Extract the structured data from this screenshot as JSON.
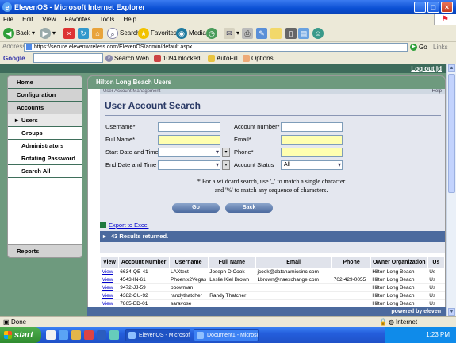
{
  "window": {
    "title": "ElevenOS - Microsoft Internet Explorer"
  },
  "menubar": [
    "File",
    "Edit",
    "View",
    "Favorites",
    "Tools",
    "Help"
  ],
  "toolbar": {
    "back": "Back",
    "search": "Search",
    "favorites": "Favorites",
    "media": "Media"
  },
  "address": {
    "label": "Address",
    "url": "https://secure.elevenwireless.com/ElevenOS/admin/default.aspx",
    "go": "Go",
    "links": "Links"
  },
  "googlebar": {
    "brand": "Google",
    "search_web": "Search Web",
    "blocked": "1094 blocked",
    "autofill": "AutoFill",
    "options": "Options"
  },
  "header": {
    "logout": "Log out jd"
  },
  "sidebar": {
    "items": [
      {
        "label": "Home"
      },
      {
        "label": "Configuration"
      },
      {
        "label": "Accounts"
      },
      {
        "label": "Users"
      },
      {
        "label": "Groups"
      },
      {
        "label": "Administrators"
      },
      {
        "label": "Rotating Password"
      },
      {
        "label": "Search All"
      }
    ],
    "reports": "Reports"
  },
  "main": {
    "title": "Hilton Long Beach  Users",
    "panel_header": "User Account Management",
    "panel_help": "Help",
    "form_title": "User Account Search",
    "fields": {
      "username": "Username*",
      "full_name": "Full Name*",
      "start_date": "Start Date and Time",
      "end_date": "End Date and Time",
      "account_number": "Account number*",
      "email": "Email*",
      "phone": "Phone*",
      "account_status": "Account Status",
      "account_status_value": "All"
    },
    "hint_line1": "* For a wildcard search, use '_' to match a single character",
    "hint_line2": "and '%' to match any sequence of characters.",
    "go_button": "Go",
    "back_button": "Back",
    "export": "Export to Excel",
    "results": "43 Results returned."
  },
  "table": {
    "headers": [
      "View",
      "Account Number",
      "Username",
      "Full Name",
      "Email",
      "Phone",
      "Owner Organization",
      "Us"
    ],
    "rows": [
      [
        "View",
        "6634-QE-41",
        "LAXtest",
        "Joseph D Cook",
        "jcook@datanamicsinc.com",
        "",
        "Hilton Long Beach",
        "Us"
      ],
      [
        "View",
        "4543-IN-61",
        "Phoenix2Vegas",
        "Leslie Kiel Brown",
        "Lbrown@naexchange.com",
        "702-429-0055",
        "Hilton Long Beach",
        "Us"
      ],
      [
        "View",
        "9472-JJ-59",
        "bbowman",
        "",
        "",
        "",
        "Hilton Long Beach",
        "Us"
      ],
      [
        "View",
        "4382-CU-92",
        "randythatcher",
        "Randy Thatcher",
        "",
        "",
        "Hilton Long Beach",
        "Us"
      ],
      [
        "View",
        "7865-ED-01",
        "saravose",
        "",
        "",
        "",
        "Hilton Long Beach",
        "Us"
      ]
    ]
  },
  "footer": {
    "powered": "powered by eleven"
  },
  "status": {
    "left": "Done",
    "zone": "Internet"
  },
  "taskbar": {
    "start": "start",
    "tasks": [
      "ElevenOS - Microsoft ...",
      "Document1 - Microsoft ..."
    ],
    "clock": "1:23 PM"
  }
}
